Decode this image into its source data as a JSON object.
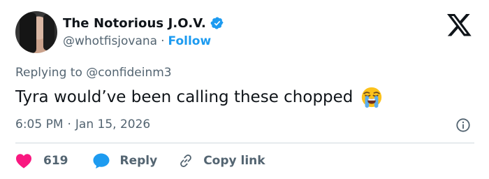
{
  "author": {
    "display_name": "The Notorious J.O.V.",
    "handle": "@whotfisjovana",
    "separator": "·",
    "follow_label": "Follow",
    "verified_color": "#1d9bf0"
  },
  "reply_context": {
    "text": "Replying to @confideinm3"
  },
  "tweet": {
    "text": "Tyra would’ve been calling these chopped",
    "emoji": "loudly-crying-face"
  },
  "meta": {
    "time": "6:05 PM",
    "separator": "·",
    "date": "Jan 15, 2026"
  },
  "actions": {
    "like_count": "619",
    "reply_label": "Reply",
    "copy_link_label": "Copy link"
  },
  "colors": {
    "accent": "#1d9bf0",
    "like": "#f91880",
    "text_primary": "#0f1419",
    "text_secondary": "#536471"
  },
  "icons": [
    "x-logo-icon",
    "verified-badge-icon",
    "info-icon",
    "heart-icon",
    "reply-bubble-icon",
    "link-icon"
  ]
}
